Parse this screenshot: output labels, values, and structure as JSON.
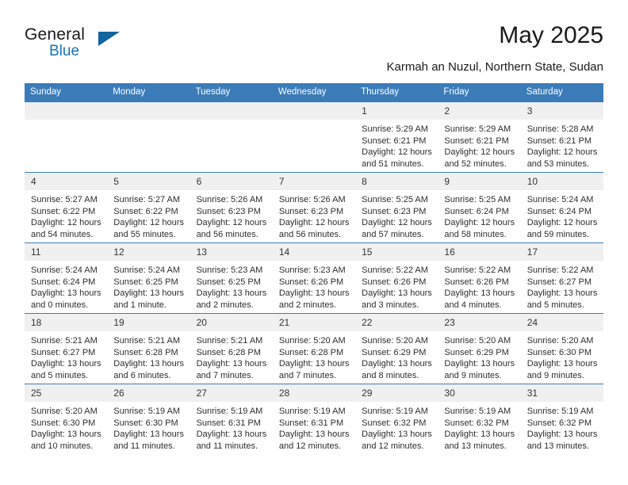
{
  "brand": {
    "word1": "General",
    "word2": "Blue",
    "triangle_color": "#10649f",
    "blue_color": "#1a72ba"
  },
  "header": {
    "title": "May 2025",
    "location": "Karmah an Nuzul, Northern State, Sudan"
  },
  "calendar": {
    "header_bg": "#3b7cb8",
    "daynum_bg": "#f0f0f0",
    "weekdays": [
      "Sunday",
      "Monday",
      "Tuesday",
      "Wednesday",
      "Thursday",
      "Friday",
      "Saturday"
    ],
    "weeks": [
      [
        {
          "day": "",
          "empty": true
        },
        {
          "day": "",
          "empty": true
        },
        {
          "day": "",
          "empty": true
        },
        {
          "day": "",
          "empty": true
        },
        {
          "day": "1",
          "sunrise": "Sunrise: 5:29 AM",
          "sunset": "Sunset: 6:21 PM",
          "daylight_line1": "Daylight: 12 hours",
          "daylight_line2": "and 51 minutes."
        },
        {
          "day": "2",
          "sunrise": "Sunrise: 5:29 AM",
          "sunset": "Sunset: 6:21 PM",
          "daylight_line1": "Daylight: 12 hours",
          "daylight_line2": "and 52 minutes."
        },
        {
          "day": "3",
          "sunrise": "Sunrise: 5:28 AM",
          "sunset": "Sunset: 6:21 PM",
          "daylight_line1": "Daylight: 12 hours",
          "daylight_line2": "and 53 minutes."
        }
      ],
      [
        {
          "day": "4",
          "sunrise": "Sunrise: 5:27 AM",
          "sunset": "Sunset: 6:22 PM",
          "daylight_line1": "Daylight: 12 hours",
          "daylight_line2": "and 54 minutes."
        },
        {
          "day": "5",
          "sunrise": "Sunrise: 5:27 AM",
          "sunset": "Sunset: 6:22 PM",
          "daylight_line1": "Daylight: 12 hours",
          "daylight_line2": "and 55 minutes."
        },
        {
          "day": "6",
          "sunrise": "Sunrise: 5:26 AM",
          "sunset": "Sunset: 6:23 PM",
          "daylight_line1": "Daylight: 12 hours",
          "daylight_line2": "and 56 minutes."
        },
        {
          "day": "7",
          "sunrise": "Sunrise: 5:26 AM",
          "sunset": "Sunset: 6:23 PM",
          "daylight_line1": "Daylight: 12 hours",
          "daylight_line2": "and 56 minutes."
        },
        {
          "day": "8",
          "sunrise": "Sunrise: 5:25 AM",
          "sunset": "Sunset: 6:23 PM",
          "daylight_line1": "Daylight: 12 hours",
          "daylight_line2": "and 57 minutes."
        },
        {
          "day": "9",
          "sunrise": "Sunrise: 5:25 AM",
          "sunset": "Sunset: 6:24 PM",
          "daylight_line1": "Daylight: 12 hours",
          "daylight_line2": "and 58 minutes."
        },
        {
          "day": "10",
          "sunrise": "Sunrise: 5:24 AM",
          "sunset": "Sunset: 6:24 PM",
          "daylight_line1": "Daylight: 12 hours",
          "daylight_line2": "and 59 minutes."
        }
      ],
      [
        {
          "day": "11",
          "sunrise": "Sunrise: 5:24 AM",
          "sunset": "Sunset: 6:24 PM",
          "daylight_line1": "Daylight: 13 hours",
          "daylight_line2": "and 0 minutes."
        },
        {
          "day": "12",
          "sunrise": "Sunrise: 5:24 AM",
          "sunset": "Sunset: 6:25 PM",
          "daylight_line1": "Daylight: 13 hours",
          "daylight_line2": "and 1 minute."
        },
        {
          "day": "13",
          "sunrise": "Sunrise: 5:23 AM",
          "sunset": "Sunset: 6:25 PM",
          "daylight_line1": "Daylight: 13 hours",
          "daylight_line2": "and 2 minutes."
        },
        {
          "day": "14",
          "sunrise": "Sunrise: 5:23 AM",
          "sunset": "Sunset: 6:26 PM",
          "daylight_line1": "Daylight: 13 hours",
          "daylight_line2": "and 2 minutes."
        },
        {
          "day": "15",
          "sunrise": "Sunrise: 5:22 AM",
          "sunset": "Sunset: 6:26 PM",
          "daylight_line1": "Daylight: 13 hours",
          "daylight_line2": "and 3 minutes."
        },
        {
          "day": "16",
          "sunrise": "Sunrise: 5:22 AM",
          "sunset": "Sunset: 6:26 PM",
          "daylight_line1": "Daylight: 13 hours",
          "daylight_line2": "and 4 minutes."
        },
        {
          "day": "17",
          "sunrise": "Sunrise: 5:22 AM",
          "sunset": "Sunset: 6:27 PM",
          "daylight_line1": "Daylight: 13 hours",
          "daylight_line2": "and 5 minutes."
        }
      ],
      [
        {
          "day": "18",
          "sunrise": "Sunrise: 5:21 AM",
          "sunset": "Sunset: 6:27 PM",
          "daylight_line1": "Daylight: 13 hours",
          "daylight_line2": "and 5 minutes."
        },
        {
          "day": "19",
          "sunrise": "Sunrise: 5:21 AM",
          "sunset": "Sunset: 6:28 PM",
          "daylight_line1": "Daylight: 13 hours",
          "daylight_line2": "and 6 minutes."
        },
        {
          "day": "20",
          "sunrise": "Sunrise: 5:21 AM",
          "sunset": "Sunset: 6:28 PM",
          "daylight_line1": "Daylight: 13 hours",
          "daylight_line2": "and 7 minutes."
        },
        {
          "day": "21",
          "sunrise": "Sunrise: 5:20 AM",
          "sunset": "Sunset: 6:28 PM",
          "daylight_line1": "Daylight: 13 hours",
          "daylight_line2": "and 7 minutes."
        },
        {
          "day": "22",
          "sunrise": "Sunrise: 5:20 AM",
          "sunset": "Sunset: 6:29 PM",
          "daylight_line1": "Daylight: 13 hours",
          "daylight_line2": "and 8 minutes."
        },
        {
          "day": "23",
          "sunrise": "Sunrise: 5:20 AM",
          "sunset": "Sunset: 6:29 PM",
          "daylight_line1": "Daylight: 13 hours",
          "daylight_line2": "and 9 minutes."
        },
        {
          "day": "24",
          "sunrise": "Sunrise: 5:20 AM",
          "sunset": "Sunset: 6:30 PM",
          "daylight_line1": "Daylight: 13 hours",
          "daylight_line2": "and 9 minutes."
        }
      ],
      [
        {
          "day": "25",
          "sunrise": "Sunrise: 5:20 AM",
          "sunset": "Sunset: 6:30 PM",
          "daylight_line1": "Daylight: 13 hours",
          "daylight_line2": "and 10 minutes."
        },
        {
          "day": "26",
          "sunrise": "Sunrise: 5:19 AM",
          "sunset": "Sunset: 6:30 PM",
          "daylight_line1": "Daylight: 13 hours",
          "daylight_line2": "and 11 minutes."
        },
        {
          "day": "27",
          "sunrise": "Sunrise: 5:19 AM",
          "sunset": "Sunset: 6:31 PM",
          "daylight_line1": "Daylight: 13 hours",
          "daylight_line2": "and 11 minutes."
        },
        {
          "day": "28",
          "sunrise": "Sunrise: 5:19 AM",
          "sunset": "Sunset: 6:31 PM",
          "daylight_line1": "Daylight: 13 hours",
          "daylight_line2": "and 12 minutes."
        },
        {
          "day": "29",
          "sunrise": "Sunrise: 5:19 AM",
          "sunset": "Sunset: 6:32 PM",
          "daylight_line1": "Daylight: 13 hours",
          "daylight_line2": "and 12 minutes."
        },
        {
          "day": "30",
          "sunrise": "Sunrise: 5:19 AM",
          "sunset": "Sunset: 6:32 PM",
          "daylight_line1": "Daylight: 13 hours",
          "daylight_line2": "and 13 minutes."
        },
        {
          "day": "31",
          "sunrise": "Sunrise: 5:19 AM",
          "sunset": "Sunset: 6:32 PM",
          "daylight_line1": "Daylight: 13 hours",
          "daylight_line2": "and 13 minutes."
        }
      ]
    ]
  }
}
